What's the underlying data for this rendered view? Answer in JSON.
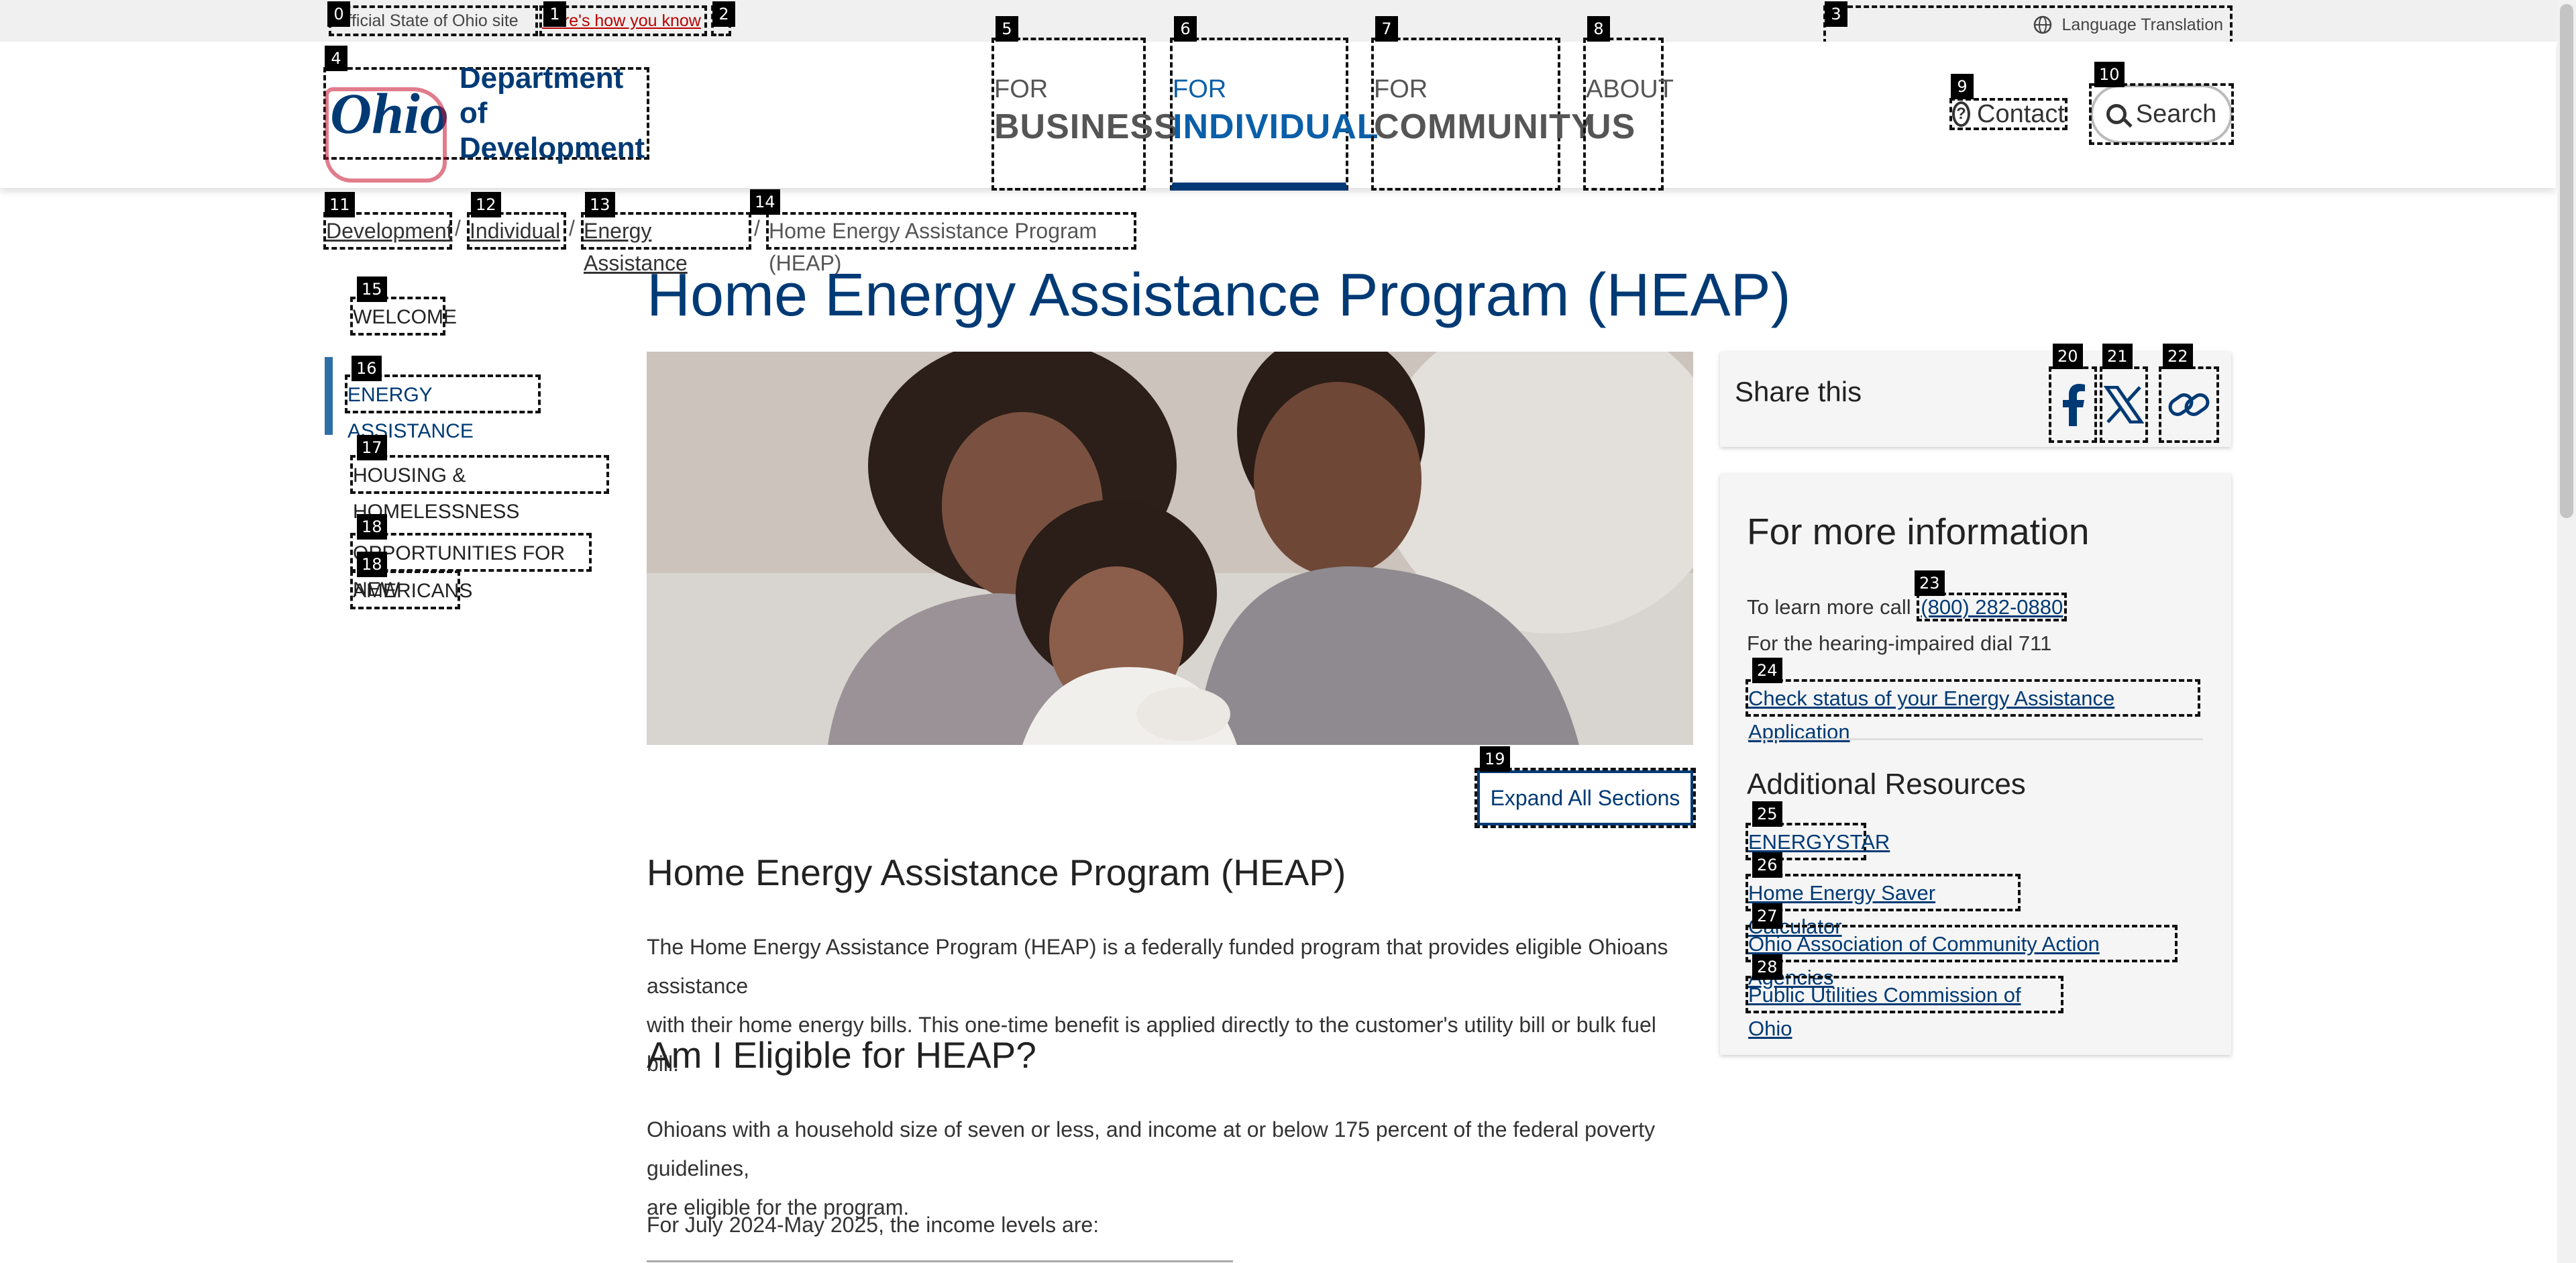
{
  "banner": {
    "official_text": "Official State of Ohio site",
    "how_know_link": "Here's how you know",
    "language_label": "Language Translation",
    "globe_icon": "globe-icon"
  },
  "header": {
    "logo_wordmark": "Ohio",
    "logo_line1": "Department of",
    "logo_line2": "Development",
    "nav": [
      {
        "kicker": "FOR",
        "label": "BUSINESS"
      },
      {
        "kicker": "FOR",
        "label": "INDIVIDUAL"
      },
      {
        "kicker": "FOR",
        "label": "COMMUNITY"
      },
      {
        "kicker": "ABOUT",
        "label": "US"
      }
    ],
    "contact_label": "Contact",
    "search_label": "Search"
  },
  "breadcrumb": {
    "items": [
      "Development",
      "Individual",
      "Energy Assistance"
    ],
    "current": "Home Energy Assistance Program (HEAP)",
    "separator": "/"
  },
  "sidebar": {
    "items": [
      "WELCOME",
      "ENERGY ASSISTANCE",
      "HOUSING & HOMELESSNESS",
      "OPPORTUNITIES FOR NEW",
      "AMERICANS"
    ]
  },
  "main": {
    "title": "Home Energy Assistance Program (HEAP)",
    "expand_label": "Expand All Sections",
    "section_title": "Home Energy Assistance Program (HEAP)",
    "intro_paragraph_line1": "The Home Energy Assistance Program (HEAP) is a federally funded program that provides eligible Ohioans assistance",
    "intro_paragraph_line2": "with their home energy bills. This one-time benefit is applied directly to the customer's utility bill or bulk fuel bill.",
    "eligibility_title": "Am I Eligible for HEAP?",
    "eligibility_line1": "Ohioans with a household size of seven or less, and income at or below 175 percent of the federal poverty guidelines,",
    "eligibility_line2": "are eligible for the program.",
    "income_intro": "For July 2024-May 2025, the income levels are:"
  },
  "share": {
    "label": "Share this",
    "icons": [
      "facebook-icon",
      "x-icon",
      "link-icon"
    ]
  },
  "info": {
    "title": "For more information",
    "call_prefix": "To learn more call",
    "phone": "(800) 282-0880",
    "hearing_text": "For the hearing-impaired dial 711",
    "status_link": "Check status of your Energy Assistance Application",
    "resources_title": "Additional Resources",
    "resources": [
      "ENERGYSTAR",
      "Home Energy Saver Calculator",
      "Ohio Association of Community Action Agencies",
      "Public Utilities Commission of Ohio"
    ]
  },
  "labels": {
    "b0": "0",
    "b1": "1",
    "b2": "2",
    "b3": "3",
    "b4": "4",
    "b5": "5",
    "b6": "6",
    "b7": "7",
    "b8": "8",
    "b9": "9",
    "b10": "10",
    "b11": "11",
    "b12": "12",
    "b13": "13",
    "b14": "14",
    "b15": "15",
    "b16": "16",
    "b17": "17",
    "b18": "18",
    "b19": "19",
    "b20": "20",
    "b21": "21",
    "b22": "22",
    "b23": "23",
    "b24": "24",
    "b25": "25",
    "b26": "26",
    "b27": "27",
    "b28": "28"
  },
  "colors": {
    "brand_blue": "#003a75",
    "link_blue": "#0a5fa8",
    "banner_red": "#b00000"
  }
}
